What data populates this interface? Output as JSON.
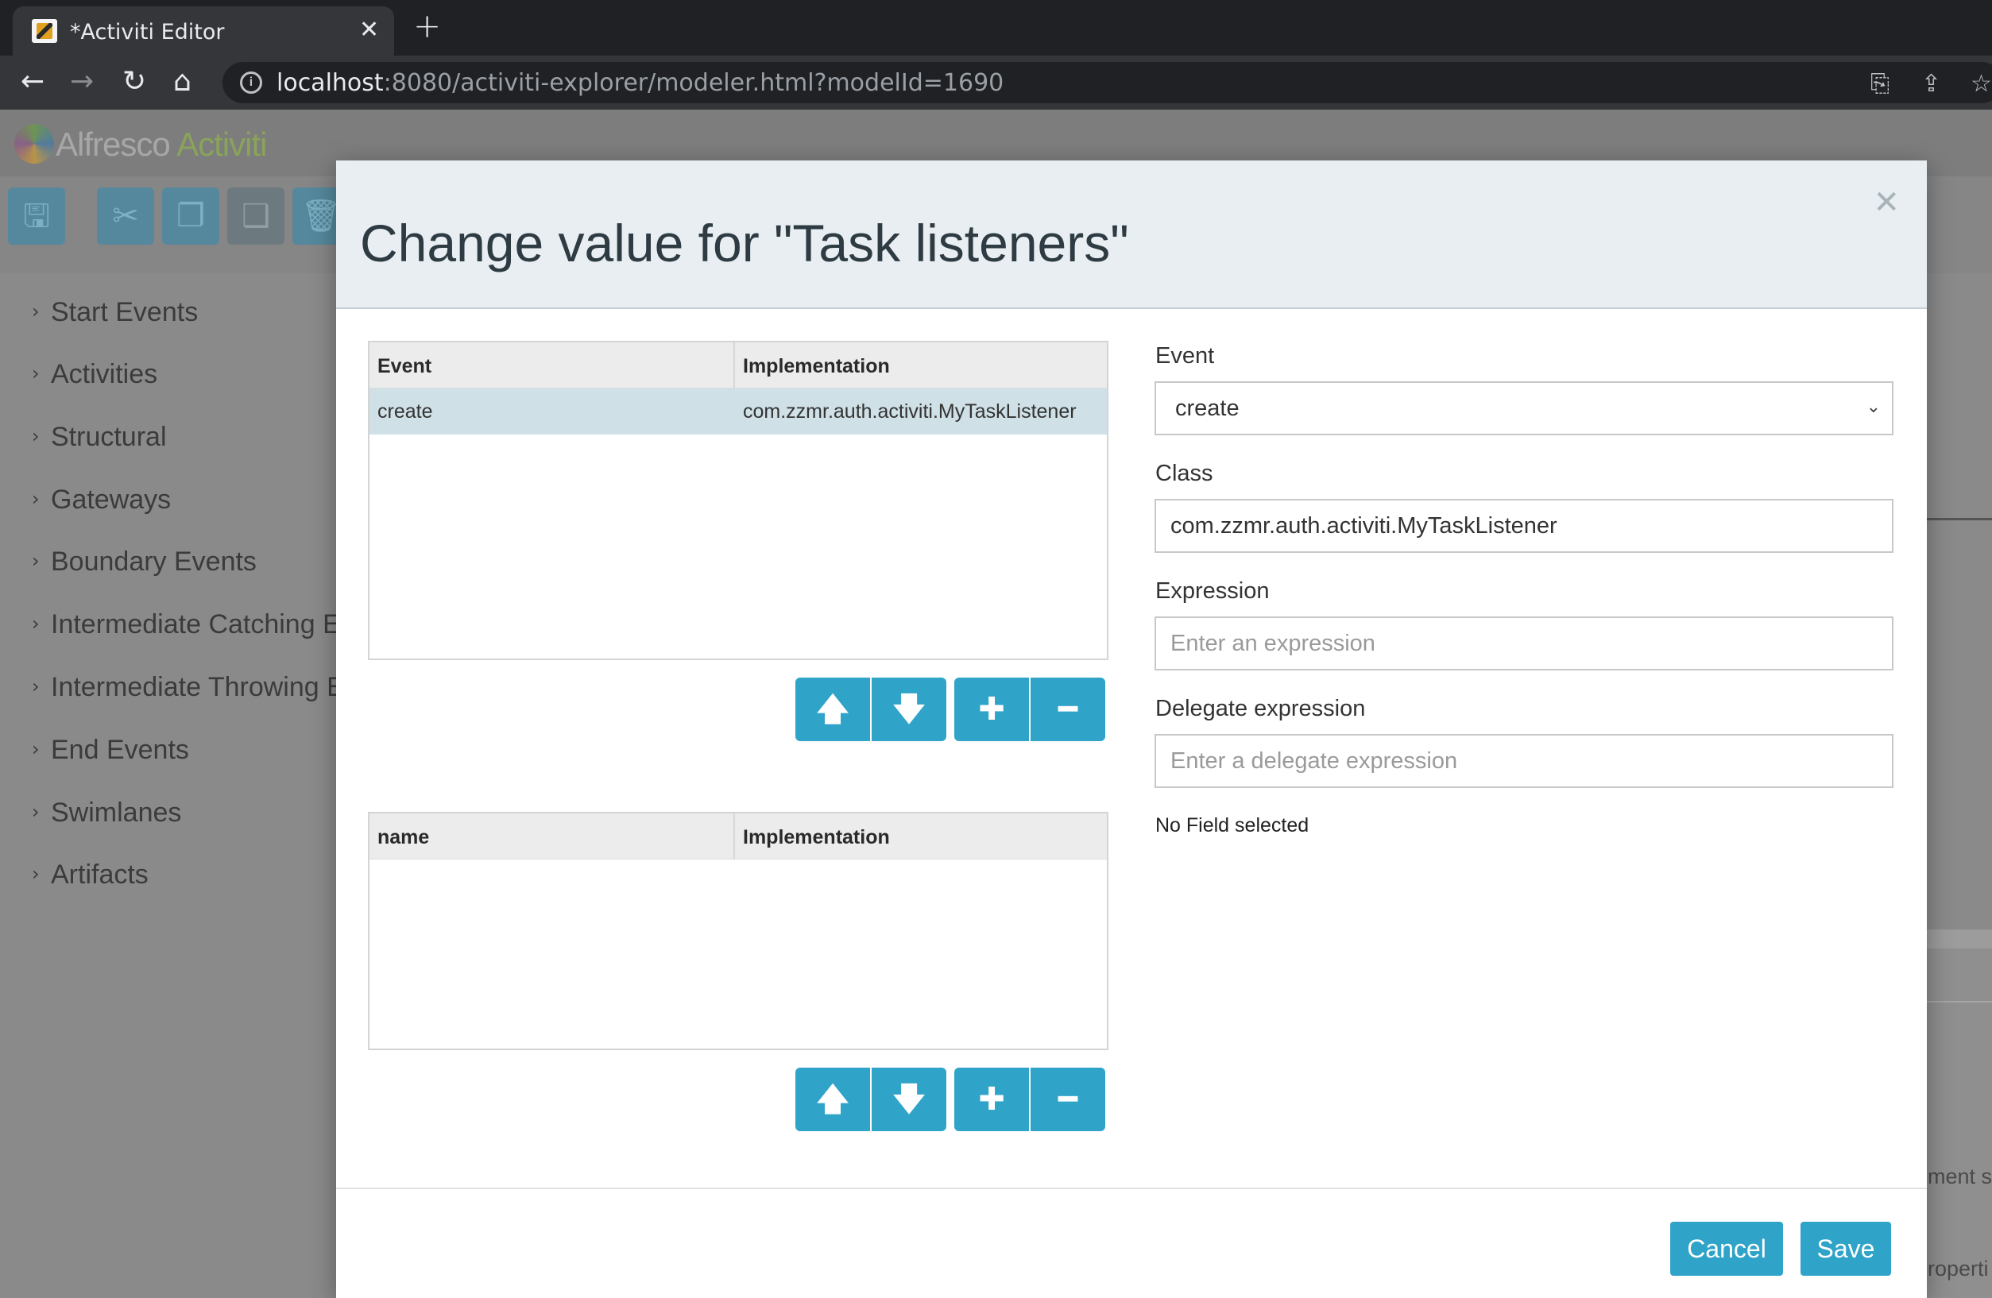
{
  "browser": {
    "tab_title": "*Activiti Editor",
    "url_host": "localhost",
    "url_rest": ":8080/activiti-explorer/modeler.html?modelId=1690"
  },
  "app": {
    "logo_text_1": "Alfresco",
    "logo_text_2": "Activiti",
    "sidebar": [
      "Start Events",
      "Activities",
      "Structural",
      "Gateways",
      "Boundary Events",
      "Intermediate Catching Events",
      "Intermediate Throwing Events",
      "End Events",
      "Swimlanes",
      "Artifacts"
    ],
    "right_peek_1": "ment s",
    "right_peek_2": "roperti"
  },
  "modal": {
    "title": "Change value for \"Task listeners\"",
    "listeners_grid": {
      "columns": [
        "Event",
        "Implementation"
      ],
      "rows": [
        {
          "event": "create",
          "implementation": "com.zzmr.auth.activiti.MyTaskListener"
        }
      ]
    },
    "fields_grid": {
      "columns": [
        "name",
        "Implementation"
      ],
      "rows": []
    },
    "form": {
      "event_label": "Event",
      "event_value": "create",
      "class_label": "Class",
      "class_value": "com.zzmr.auth.activiti.MyTaskListener",
      "expression_label": "Expression",
      "expression_placeholder": "Enter an expression",
      "delegate_label": "Delegate expression",
      "delegate_placeholder": "Enter a delegate expression",
      "no_field_text": "No Field selected"
    },
    "buttons": {
      "cancel": "Cancel",
      "save": "Save"
    },
    "colors": {
      "accent": "#2fa4c8",
      "header_bg": "#e8eef2",
      "selected_row": "#cfe0e6"
    }
  }
}
